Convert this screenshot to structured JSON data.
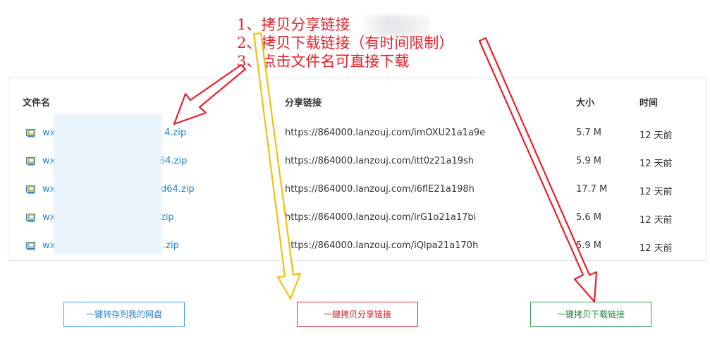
{
  "annotations": [
    "1、拷贝分享链接",
    "2、拷贝下载链接（有时间限制）",
    "3、点击文件名可直接下载"
  ],
  "table": {
    "headers": [
      "文件名",
      "分享链接",
      "大小",
      "时间"
    ],
    "rows": [
      {
        "name_prefix": "wx",
        "name_suffix": "4.zip",
        "link": "https://864000.lanzouj.com/imOXU21a1a9e",
        "size": "5.7 M",
        "time": "12 天前"
      },
      {
        "name_prefix": "wx",
        "name_suffix": "64.zip",
        "link": "https://864000.lanzouj.com/itt0z21a19sh",
        "size": "5.9 M",
        "time": "12 天前"
      },
      {
        "name_prefix": "wx",
        "name_suffix": "d64.zip",
        "link": "https://864000.lanzouj.com/i6flE21a198h",
        "size": "17.7 M",
        "time": "12 天前"
      },
      {
        "name_prefix": "wx",
        "name_suffix": "zip",
        "link": "https://864000.lanzouj.com/irG1o21a17bi",
        "size": "5.6 M",
        "time": "12 天前"
      },
      {
        "name_prefix": "wx",
        "name_suffix": ".zip",
        "link": "https://864000.lanzouj.com/iQlpa21a170h",
        "size": "5.9 M",
        "time": "12 天前"
      }
    ]
  },
  "buttons": {
    "save": "一键转存到我的网盘",
    "copy_share": "一键拷贝分享链接",
    "copy_download": "一键拷贝下载链接"
  },
  "colors": {
    "annotation_red": "#e8202a",
    "arrow_yellow": "#f2c10a",
    "link_blue": "#1a84d8",
    "share_red": "#d81e2a",
    "download_green": "#238a3f"
  },
  "icons": {
    "file": "archive-file-icon"
  }
}
